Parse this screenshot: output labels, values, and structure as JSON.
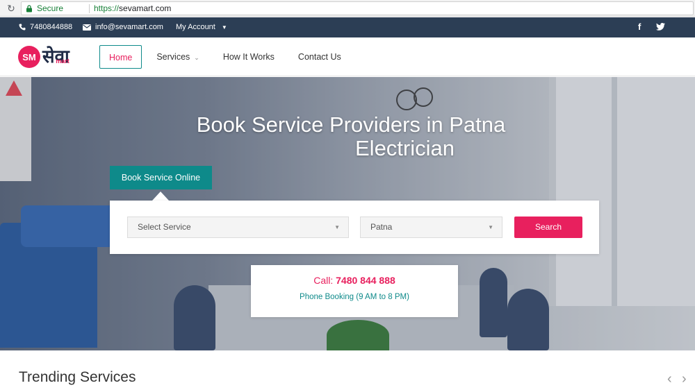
{
  "browser": {
    "secure_label": "Secure",
    "url_scheme": "https://",
    "url_host": "sevamart.com"
  },
  "topbar": {
    "phone": "7480844888",
    "email": "info@sevamart.com",
    "account_label": "My Account",
    "social": {
      "facebook": "f",
      "twitter": "t"
    }
  },
  "header": {
    "logo": {
      "initials": "SM",
      "wordmark": "सेवा",
      "sub": "mart"
    },
    "nav": {
      "home": "Home",
      "services": "Services",
      "how": "How It Works",
      "contact": "Contact Us"
    }
  },
  "hero": {
    "title": "Book Service Providers in Patna",
    "subtitle": "Electrician",
    "book_tab": "Book Service Online",
    "service_select": "Select Service",
    "city_select": "Patna",
    "search_label": "Search",
    "call_prefix": "Call:",
    "call_number": "7480 844 888",
    "booking_hours": "Phone Booking (9 AM to 8 PM)"
  },
  "trending": {
    "title": "Trending Services"
  },
  "icons": {
    "reload": "reload-icon",
    "lock": "lock-icon",
    "phone": "phone-icon",
    "mail": "mail-icon",
    "caret": "caret-down-icon",
    "facebook": "facebook-icon",
    "twitter": "twitter-icon",
    "prev": "chevron-left-icon",
    "next": "chevron-right-icon"
  },
  "colors": {
    "primary": "#e8205e",
    "teal": "#0e8a8a",
    "topbar": "#2c3e55"
  }
}
